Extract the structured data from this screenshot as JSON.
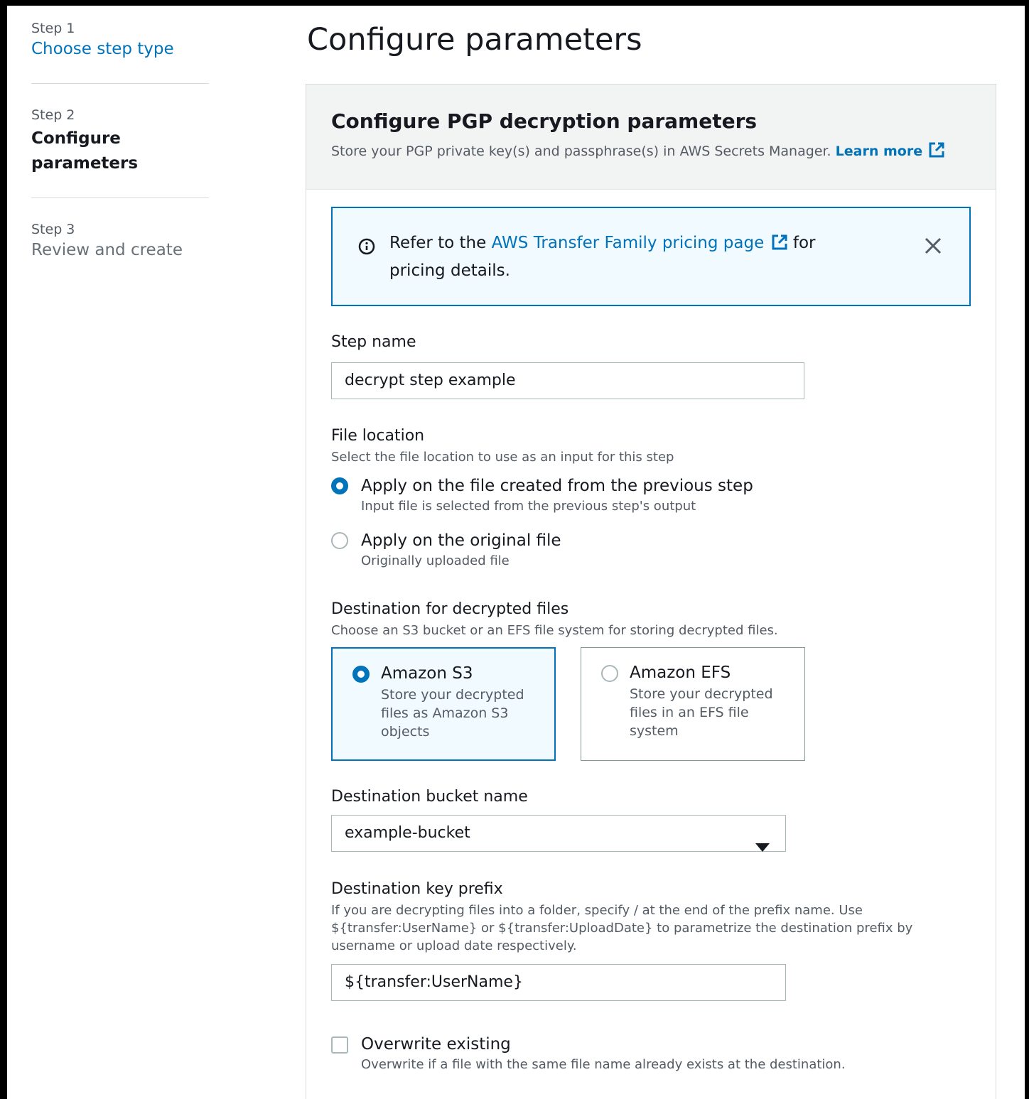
{
  "nav": {
    "step1": {
      "num": "Step 1",
      "title": "Choose step type"
    },
    "step2": {
      "num": "Step 2",
      "title_line1": "Configure",
      "title_line2": "parameters"
    },
    "step3": {
      "num": "Step 3",
      "title": "Review and create"
    }
  },
  "page_title": "Configure parameters",
  "panel": {
    "title": "Configure PGP decryption parameters",
    "description": "Store your PGP private key(s) and passphrase(s) in AWS Secrets Manager.",
    "learn_more": "Learn more"
  },
  "alert": {
    "prefix": "Refer to the",
    "link": "AWS Transfer Family pricing page",
    "suffix": "for pricing details."
  },
  "step_name": {
    "label": "Step name",
    "value": "decrypt step example"
  },
  "file_location": {
    "label": "File location",
    "description": "Select the file location to use as an input for this step",
    "options": [
      {
        "label": "Apply on the file created from the previous step",
        "sub": "Input file is selected from the previous step's output",
        "checked": true
      },
      {
        "label": "Apply on the original file",
        "sub": "Originally uploaded file",
        "checked": false
      }
    ]
  },
  "destination": {
    "label": "Destination for decrypted files",
    "description": "Choose an S3 bucket or an EFS file system for storing decrypted files.",
    "tiles": [
      {
        "title": "Amazon S3",
        "desc": "Store your decrypted files as Amazon S3 objects",
        "selected": true
      },
      {
        "title": "Amazon EFS",
        "desc": "Store your decrypted files in an EFS file system",
        "selected": false
      }
    ]
  },
  "bucket": {
    "label": "Destination bucket name",
    "value": "example-bucket"
  },
  "key_prefix": {
    "label": "Destination key prefix",
    "desc_line1": "If you are decrypting files into a folder, specify / at the end of the prefix name. Use",
    "desc_line2": "${transfer:UserName} or ${transfer:UploadDate} to parametrize the destination prefix by",
    "desc_line3": "username or upload date respectively.",
    "value": "${transfer:UserName}"
  },
  "overwrite": {
    "label": "Overwrite existing",
    "description": "Overwrite if a file with the same file name already exists at the destination.",
    "checked": false
  },
  "colors": {
    "link": "#0073bb",
    "alert_bg": "#f1faff",
    "header_bg": "#f2f3f3"
  },
  "icons": [
    "external-link-icon",
    "info-icon",
    "close-icon",
    "caret-down-icon"
  ]
}
